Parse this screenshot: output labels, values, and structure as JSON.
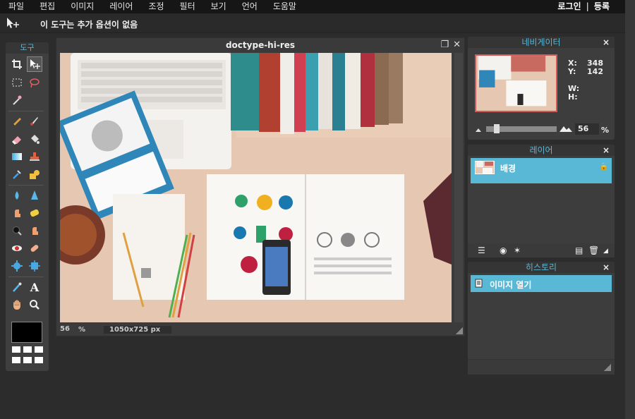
{
  "menubar": {
    "items": [
      "파일",
      "편집",
      "이미지",
      "레이어",
      "조정",
      "필터",
      "보기",
      "언어",
      "도움말"
    ],
    "login": "로그인",
    "separator": "|",
    "register": "등록"
  },
  "optionsbar": {
    "text": "이 도구는 추가 옵션이 없음"
  },
  "tools": {
    "title": "도구"
  },
  "document": {
    "title": "doctype-hi-res",
    "zoom": "56",
    "zoom_unit": "%",
    "dimensions": "1050x725 px"
  },
  "navigator": {
    "title": "네비게이터",
    "x_label": "X:",
    "x_value": "348",
    "y_label": "Y:",
    "y_value": "142",
    "w_label": "W:",
    "h_label": "H:",
    "zoom": "56",
    "zoom_unit": "%"
  },
  "layers": {
    "title": "레이어",
    "items": [
      {
        "name": "배경"
      }
    ]
  },
  "history": {
    "title": "히스토리",
    "items": [
      {
        "name": "이미지 열기"
      }
    ]
  },
  "colors": {
    "accent": "#59b8d6",
    "foreground": "#000000"
  }
}
